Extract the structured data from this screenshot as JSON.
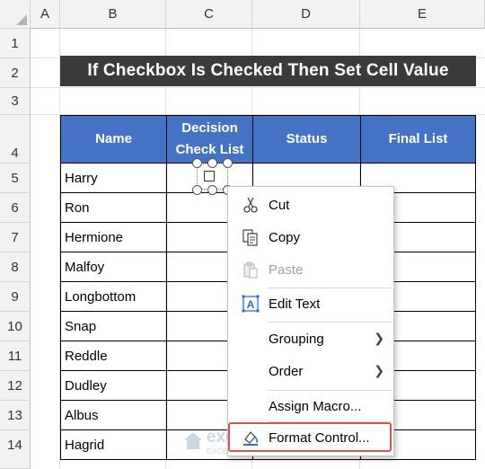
{
  "columns": [
    "A",
    "B",
    "C",
    "D",
    "E"
  ],
  "rows": [
    "1",
    "2",
    "3",
    "4",
    "5",
    "6",
    "7",
    "8",
    "9",
    "10",
    "11",
    "12",
    "13",
    "14"
  ],
  "title": "If Checkbox Is Checked Then Set Cell Value",
  "headers": {
    "name": "Name",
    "decision_line1": "Decision",
    "decision_line2": "Check List",
    "status": "Status",
    "final": "Final List"
  },
  "names": [
    "Harry",
    "Ron",
    "Hermione",
    "Malfoy",
    "Longbottom",
    "Snap",
    "Reddle",
    "Dudley",
    "Albus",
    "Hagrid"
  ],
  "context_menu": {
    "cut": {
      "label": "Cut",
      "icon": "scissors-icon"
    },
    "copy": {
      "label": "Copy",
      "icon": "copy-icon"
    },
    "paste": {
      "label": "Paste",
      "icon": "clipboard-icon",
      "disabled": true
    },
    "edit_text": {
      "label": "Edit Text",
      "icon": "text-box-icon"
    },
    "grouping": {
      "label": "Grouping"
    },
    "order": {
      "label": "Order"
    },
    "assign_macro": {
      "label": "Assign Macro..."
    },
    "format_control": {
      "label": "Format Control...",
      "icon": "format-control-icon"
    }
  },
  "watermark": {
    "name": "exceldemy",
    "sub": "EXCEL · DATA · BI"
  },
  "colors": {
    "title_bg": "#3b3b3b",
    "header_bg": "#4472c4",
    "highlight": "#d9534f"
  }
}
